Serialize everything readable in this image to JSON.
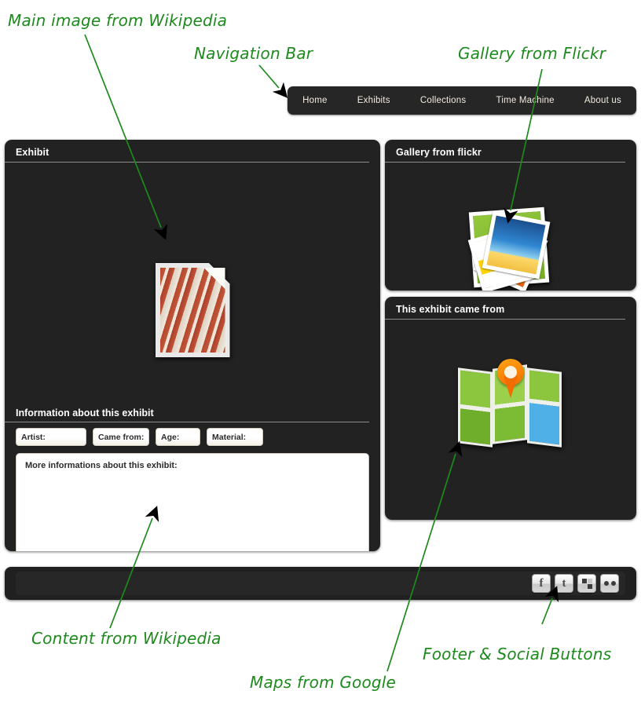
{
  "navbar": {
    "items": [
      {
        "label": "Home"
      },
      {
        "label": "Exhibits"
      },
      {
        "label": "Collections"
      },
      {
        "label": "Time Machine"
      },
      {
        "label": "About us"
      }
    ]
  },
  "panels": {
    "exhibit": {
      "title": "Exhibit",
      "image_icon": "image-placeholder-icon",
      "info": {
        "title": "Information about this exhibit",
        "fields": [
          {
            "label": "Artist:",
            "value": ""
          },
          {
            "label": "Came from:",
            "value": ""
          },
          {
            "label": "Age:",
            "value": ""
          },
          {
            "label": "Material:",
            "value": ""
          }
        ],
        "more": {
          "label": "More informations about this exhibit:",
          "value": ""
        }
      }
    },
    "gallery": {
      "title": "Gallery from flickr",
      "icon": "photo-stack-icon"
    },
    "origin": {
      "title": "This exhibit came from",
      "icon": "map-pin-icon"
    }
  },
  "footer": {
    "social": [
      {
        "name": "facebook",
        "glyph": "f"
      },
      {
        "name": "twitter",
        "glyph": "t"
      },
      {
        "name": "windows-grid",
        "glyph": ""
      },
      {
        "name": "flickr",
        "glyph": ""
      }
    ]
  },
  "annotations": {
    "color": "#1c8a1c",
    "items": [
      {
        "text": "Main image from Wikipedia"
      },
      {
        "text": "Navigation Bar"
      },
      {
        "text": "Gallery from Flickr"
      },
      {
        "text": "Content from Wikipedia"
      },
      {
        "text": "Maps from Google"
      },
      {
        "text": "Footer & Social Buttons"
      }
    ]
  }
}
